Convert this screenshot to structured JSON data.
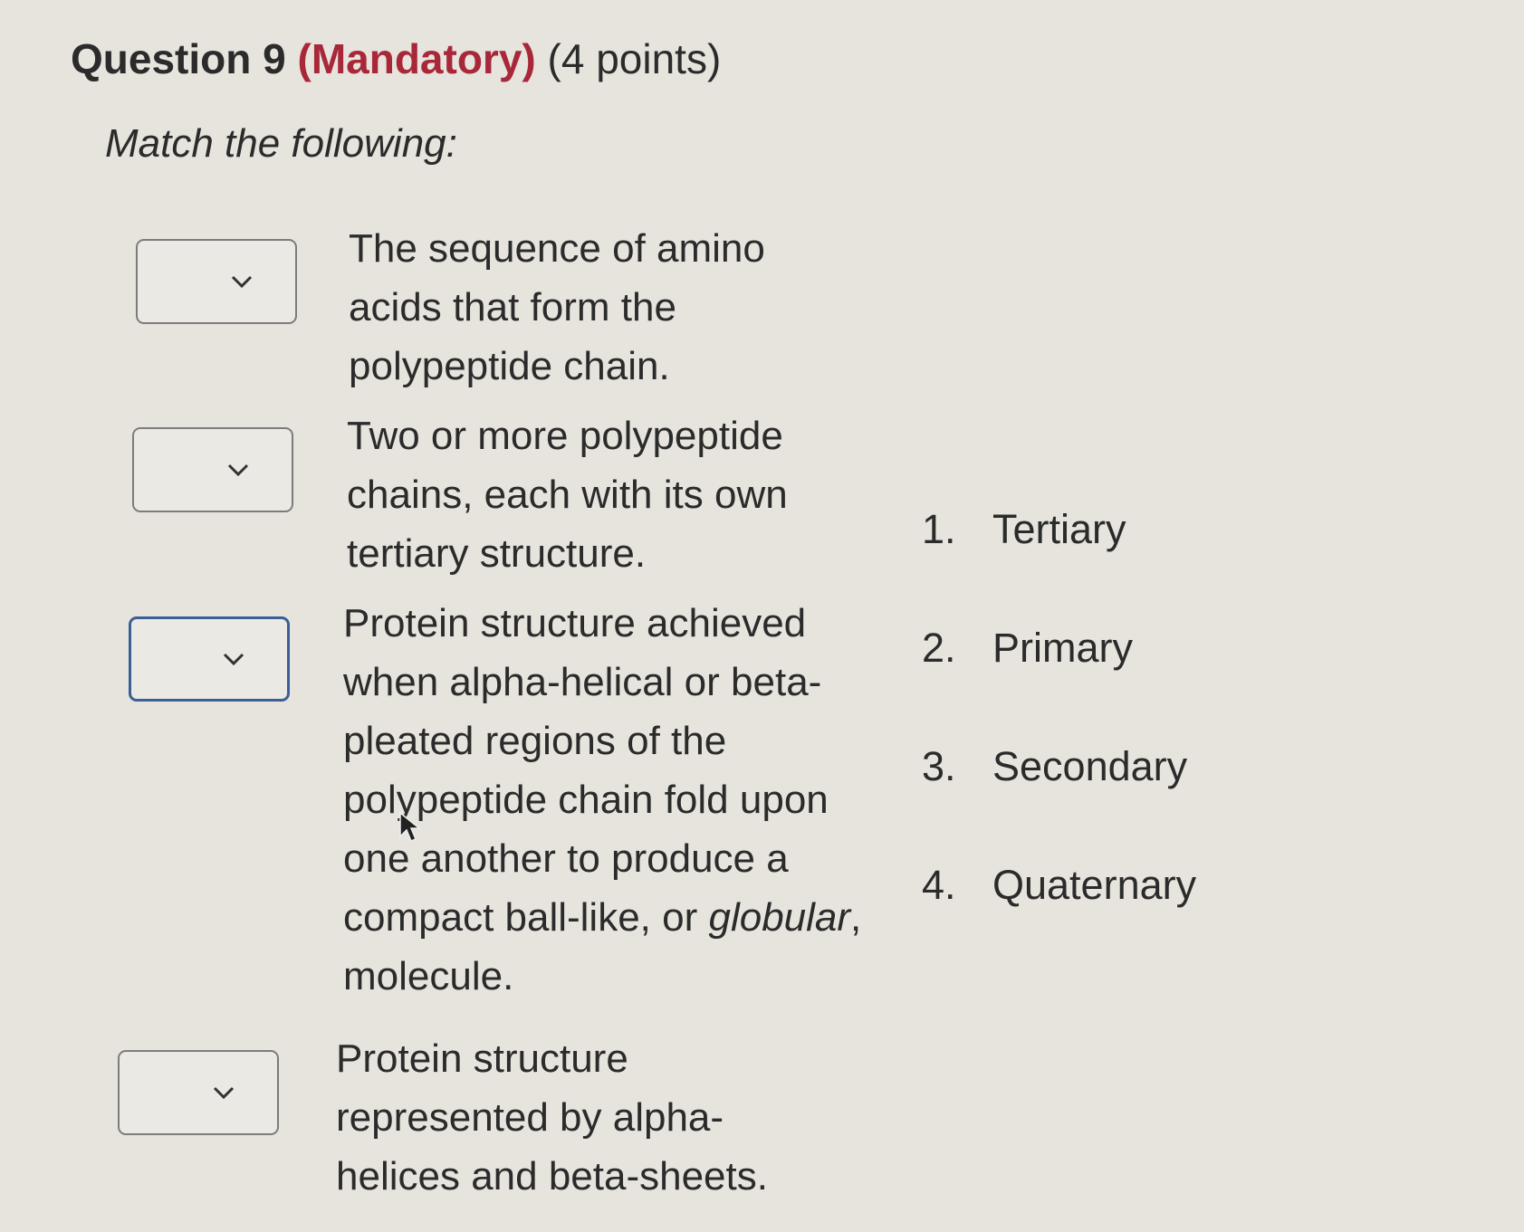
{
  "question": {
    "label": "Question 9",
    "mandatory": "(Mandatory)",
    "points": "(4 points)",
    "instruction": "Match the following:"
  },
  "prompts": [
    {
      "text": "The sequence of amino acids that form the polypeptide chain.",
      "selected": ""
    },
    {
      "text": "Two or more polypeptide chains, each with its own tertiary structure.",
      "selected": ""
    },
    {
      "text_before": "Protein structure achieved when alpha-helical or beta-pleated regions of the polypeptide chain fold upon one another to produce a compact ball-like, or ",
      "text_italic": "globular",
      "text_after": ", molecule.",
      "selected": ""
    },
    {
      "text": "Protein structure represented by alpha-helices and beta-sheets.",
      "selected": ""
    }
  ],
  "options": [
    {
      "num": "1.",
      "label": "Tertiary"
    },
    {
      "num": "2.",
      "label": "Primary"
    },
    {
      "num": "3.",
      "label": "Secondary"
    },
    {
      "num": "4.",
      "label": "Quaternary"
    }
  ],
  "icons": {
    "dropdown": "chevron-down-icon",
    "pointer": "mouse-pointer-icon"
  },
  "colors": {
    "mandatory": "#a8283a",
    "focus_border": "#3c5f96"
  }
}
